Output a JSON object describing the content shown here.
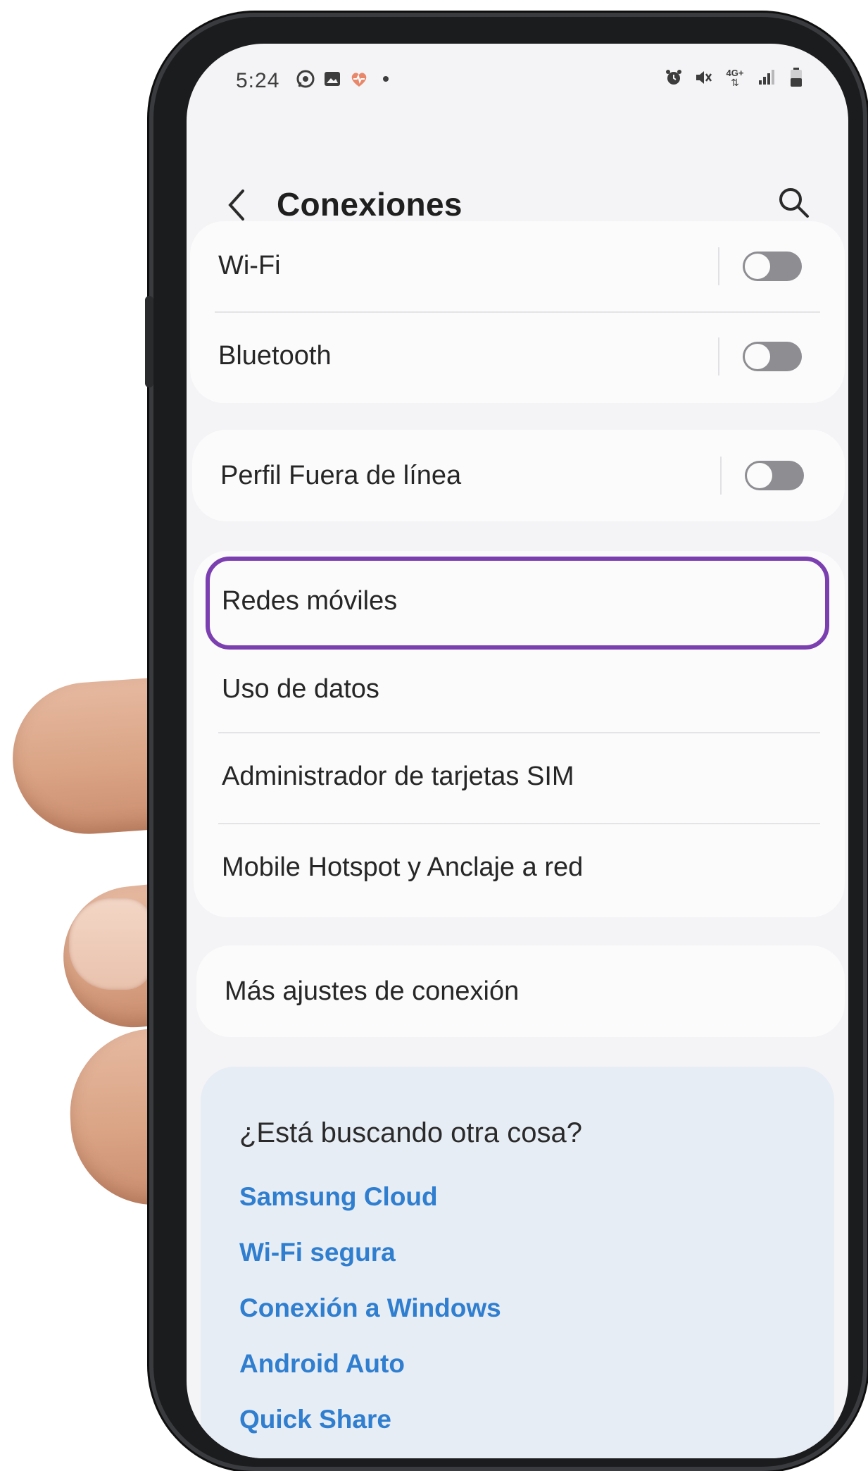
{
  "status_bar": {
    "time": "5:24",
    "left_icons": [
      "whatsapp-icon",
      "gallery-icon",
      "health-icon",
      "dot-icon"
    ],
    "right_icons": [
      "alarm-icon",
      "mute-icon",
      "network-4g-icon",
      "signal-icon",
      "battery-icon"
    ],
    "network_label": "4G+"
  },
  "header": {
    "title": "Conexiones"
  },
  "group1": [
    {
      "label": "Wi-Fi",
      "toggle": false
    },
    {
      "label": "Bluetooth",
      "toggle": false
    }
  ],
  "group2": [
    {
      "label": "Perfil Fuera de línea",
      "toggle": false
    }
  ],
  "group3": [
    {
      "label": "Redes móviles"
    },
    {
      "label": "Uso de datos"
    },
    {
      "label": "Administrador de tarjetas SIM"
    },
    {
      "label": "Mobile Hotspot y Anclaje a red"
    }
  ],
  "group4": [
    {
      "label": "Más ajustes de conexión"
    }
  ],
  "suggestions": {
    "title": "¿Está buscando otra cosa?",
    "links": [
      "Samsung Cloud",
      "Wi-Fi segura",
      "Conexión a Windows",
      "Android Auto",
      "Quick Share"
    ]
  },
  "colors": {
    "highlight": "#7b3fb0",
    "link": "#2f7ecf",
    "toggle_off": "#8e8e92"
  }
}
